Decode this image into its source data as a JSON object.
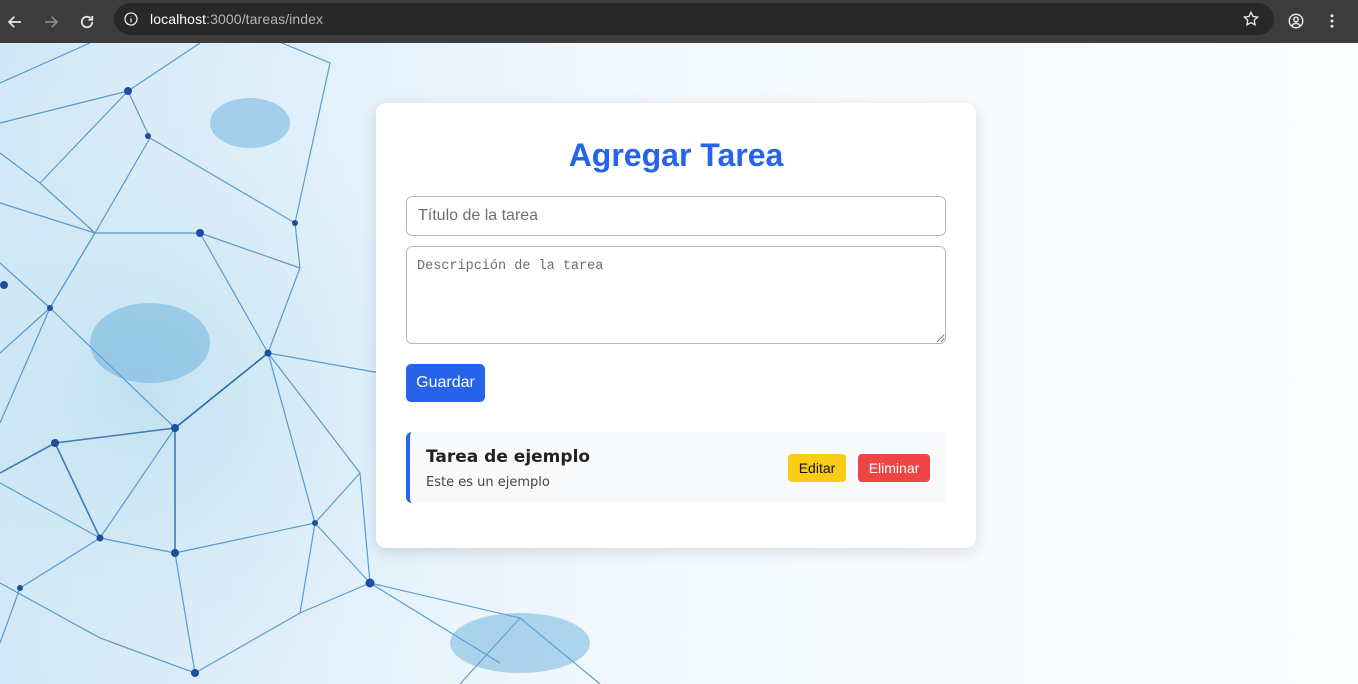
{
  "browser": {
    "url_host": "localhost",
    "url_rest": ":3000/tareas/index",
    "icons": [
      "back-icon",
      "forward-icon",
      "reload-icon",
      "info-icon",
      "star-icon",
      "profile-icon",
      "menu-icon"
    ]
  },
  "form": {
    "heading": "Agregar Tarea",
    "title_placeholder": "Título de la tarea",
    "title_value": "",
    "description_placeholder": "Descripción de la tarea",
    "description_value": "",
    "save_label": "Guardar"
  },
  "tasks": [
    {
      "title": "Tarea de ejemplo",
      "description": "Este es un ejemplo",
      "edit_label": "Editar",
      "delete_label": "Eliminar"
    }
  ],
  "colors": {
    "accent": "#2563eb",
    "edit": "#facc15",
    "delete": "#ef4444"
  }
}
